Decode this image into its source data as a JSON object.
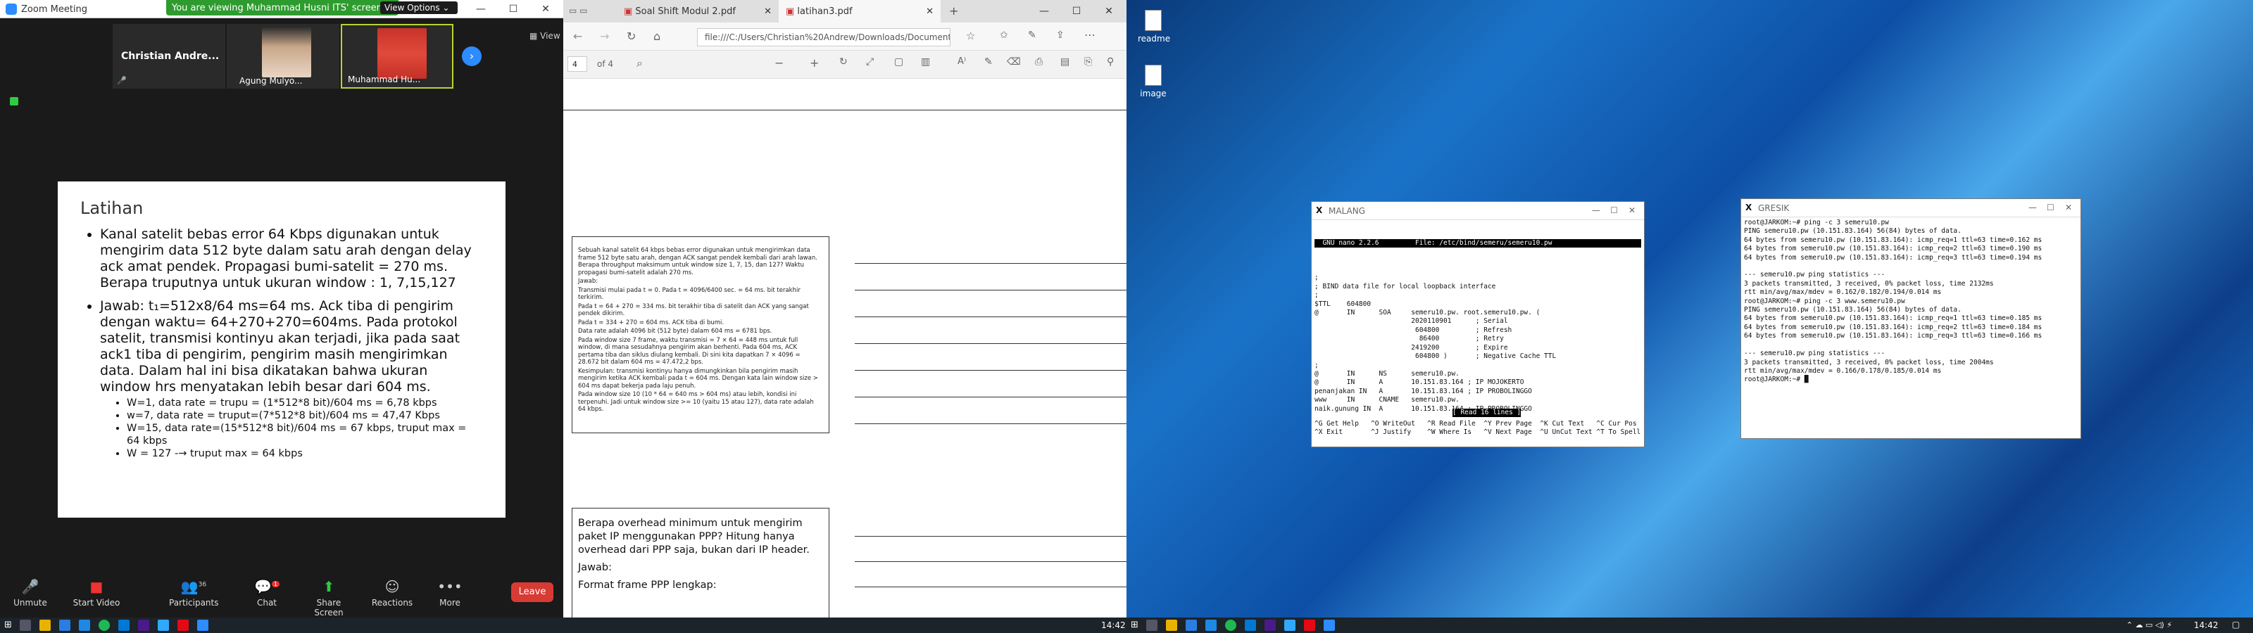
{
  "zoom": {
    "title": "Zoom Meeting",
    "banner": "You are viewing Muhammad  Husni ITS' screen",
    "view_options": "View Options ⌄",
    "view_label": "View",
    "participants": [
      {
        "name": "Christian  Andre..."
      },
      {
        "name": "Agung Mulyo..."
      },
      {
        "name": "Muhammad  Hu..."
      }
    ],
    "slide": {
      "title": "Latihan",
      "bullet1": "Kanal satelit bebas error 64 Kbps digunakan untuk mengirim data 512 byte dalam satu arah dengan delay ack amat pendek. Propagasi bumi-satelit = 270 ms. Berapa truputnya untuk ukuran window : 1, 7,15,127",
      "bullet2": "Jawab: t₁=512x8/64 ms=64 ms. Ack tiba di pengirim dengan waktu= 64+270+270=604ms. Pada protokol satelit, transmisi kontinyu akan terjadi, jika pada saat ack1 tiba di pengirim, pengirim masih mengirimkan data. Dalam hal ini bisa dikatakan bahwa ukuran window hrs menyatakan lebih besar dari 604 ms.",
      "sub": [
        "W=1, data rate = trupu = (1*512*8 bit)/604 ms = 6,78 kbps",
        "w=7, data rate = truput=(7*512*8 bit)/604 ms = 47,47 Kbps",
        "W=15, data rate=(15*512*8 bit)/604 ms =  67 kbps, truput max = 64 kbps",
        "W = 127 -→ truput max = 64 kbps"
      ]
    },
    "toolbar": {
      "unmute": "Unmute",
      "start_video": "Start Video",
      "participants": "Participants",
      "participants_count": "36",
      "chat": "Chat",
      "chat_badge": "1",
      "share": "Share Screen",
      "reactions": "Reactions",
      "more": "More",
      "leave": "Leave"
    }
  },
  "edge": {
    "tabs": [
      {
        "label": "Soal Shift Modul 2.pdf"
      },
      {
        "label": "latihan3.pdf"
      }
    ],
    "url": "file:///C:/Users/Christian%20Andrew/Downloads/Documents/lati",
    "page_input": "4",
    "page_total": "of 4",
    "box1": [
      "Sebuah kanal satelit 64 kbps bebas error digunakan untuk mengirimkan data frame 512 byte satu arah, dengan ACK sangat pendek kembali dari arah lawan. Berapa throughput maksimum untuk window size 1, 7, 15, dan 127? Waktu propagasi bumi-satelit adalah 270 ms.",
      "Jawab:",
      "Transmisi mulai pada t = 0. Pada t = 4096/6400 sec. = 64 ms. bit terakhir terkirim.",
      "Pada t = 64 + 270 = 334 ms. bit terakhir tiba di satelit dan ACK yang sangat pendek dikirim.",
      "Pada t = 334 + 270 = 604 ms. ACK tiba di bumi.",
      "Data rate adalah 4096 bit (512 byte) dalam 604 ms = 6781 bps.",
      "Pada window size 7 frame, waktu transmisi = 7 × 64 = 448 ms untuk full window, di mana sesudahnya pengirim akan berhenti. Pada 604 ms, ACK pertama tiba dan siklus diulang kembali. Di sini kita dapatkan 7 × 4096 = 28.672 bit dalam 604 ms = 47.472,2 bps.",
      "Kesimpulan: transmisi kontinyu hanya dimungkinkan bila pengirim masih mengirim ketika ACK kembali pada t = 604 ms. Dengan kata lain window size > 604 ms dapat bekerja pada laju penuh.",
      "Pada window size 10 (10 * 64 = 640 ms > 604 ms) atau lebih, kondisi ini terpenuhi. Jadi untuk window size >= 10 (yaitu 15 atau 127), data rate adalah 64 kbps."
    ],
    "box2": [
      "Berapa overhead minimum untuk mengirim paket IP menggunakan PPP? Hitung hanya overhead dari PPP saja, bukan dari IP header.",
      "Jawab:",
      "Format frame PPP lengkap:"
    ]
  },
  "desktop": {
    "icons": [
      {
        "label": "readme"
      },
      {
        "label": "image"
      }
    ],
    "malang": {
      "title": "MALANG",
      "header": "  GNU nano 2.2.6         File: /etc/bind/semeru/semeru10.pw",
      "lines": [
        "",
        ";",
        "; BIND data file for local loopback interface",
        ";",
        "$TTL    604800",
        "@       IN      SOA     semeru10.pw. root.semeru10.pw. (",
        "                        2020110901      ; Serial",
        "                         604800         ; Refresh",
        "                          86400         ; Retry",
        "                        2419200         ; Expire",
        "                         604800 )       ; Negative Cache TTL",
        ";",
        "@       IN      NS      semeru10.pw.",
        "@       IN      A       10.151.83.164 ; IP MOJOKERTO",
        "penanjakan IN   A       10.151.83.164 ; IP PROBOLINGGO",
        "www     IN      CNAME   semeru10.pw.",
        "naik.gunung IN  A       10.151.83.164 ; IP PROBOLINGGO"
      ],
      "status": "[ Read 16 lines ]",
      "shortcuts1": "^G Get Help   ^O WriteOut   ^R Read File  ^Y Prev Page  ^K Cut Text   ^C Cur Pos",
      "shortcuts2": "^X Exit       ^J Justify    ^W Where Is   ^V Next Page  ^U UnCut Text ^T To Spell"
    },
    "gresik": {
      "title": "GRESIK",
      "lines": [
        "root@JARKOM:~# ping -c 3 semeru10.pw",
        "PING semeru10.pw (10.151.83.164) 56(84) bytes of data.",
        "64 bytes from semeru10.pw (10.151.83.164): icmp_req=1 ttl=63 time=0.162 ms",
        "64 bytes from semeru10.pw (10.151.83.164): icmp_req=2 ttl=63 time=0.190 ms",
        "64 bytes from semeru10.pw (10.151.83.164): icmp_req=3 ttl=63 time=0.194 ms",
        "",
        "--- semeru10.pw ping statistics ---",
        "3 packets transmitted, 3 received, 0% packet loss, time 2132ms",
        "rtt min/avg/max/mdev = 0.162/0.182/0.194/0.014 ms",
        "root@JARKOM:~# ping -c 3 www.semeru10.pw",
        "PING semeru10.pw (10.151.83.164) 56(84) bytes of data.",
        "64 bytes from semeru10.pw (10.151.83.164): icmp_req=1 ttl=63 time=0.185 ms",
        "64 bytes from semeru10.pw (10.151.83.164): icmp_req=2 ttl=63 time=0.184 ms",
        "64 bytes from semeru10.pw (10.151.83.164): icmp_req=3 ttl=63 time=0.166 ms",
        "",
        "--- semeru10.pw ping statistics ---",
        "3 packets transmitted, 3 received, 0% packet loss, time 2004ms",
        "rtt min/avg/max/mdev = 0.166/0.178/0.185/0.014 ms",
        "root@JARKOM:~# █"
      ]
    }
  },
  "taskbar": {
    "time_left": "14:42",
    "time_right": "14:42"
  }
}
